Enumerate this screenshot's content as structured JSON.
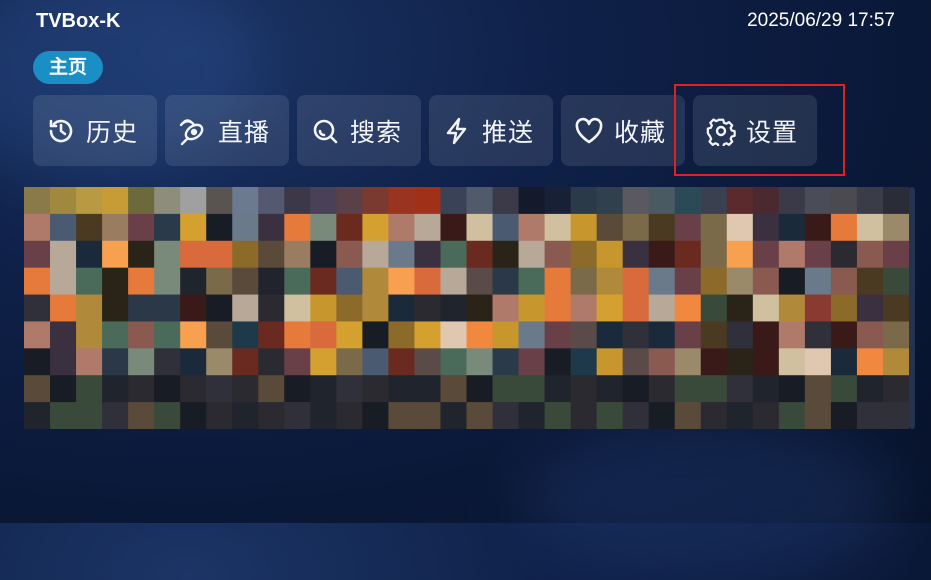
{
  "header": {
    "app_title": "TVBox-K",
    "datetime": "2025/06/29 17:57"
  },
  "home_tab": {
    "label": "主页"
  },
  "menu": [
    {
      "id": "history",
      "label": "历史",
      "icon": "history-icon"
    },
    {
      "id": "live",
      "label": "直播",
      "icon": "live-satellite-icon"
    },
    {
      "id": "search",
      "label": "搜索",
      "icon": "search-icon"
    },
    {
      "id": "push",
      "label": "推送",
      "icon": "lightning-icon"
    },
    {
      "id": "favorites",
      "label": "收藏",
      "icon": "heart-icon"
    },
    {
      "id": "settings",
      "label": "设置",
      "icon": "gear-icon"
    }
  ],
  "colors": {
    "accent": "#1a8fc6",
    "highlight": "#e0221e",
    "background": "#0f2149"
  },
  "content": {
    "description_visible": false
  }
}
